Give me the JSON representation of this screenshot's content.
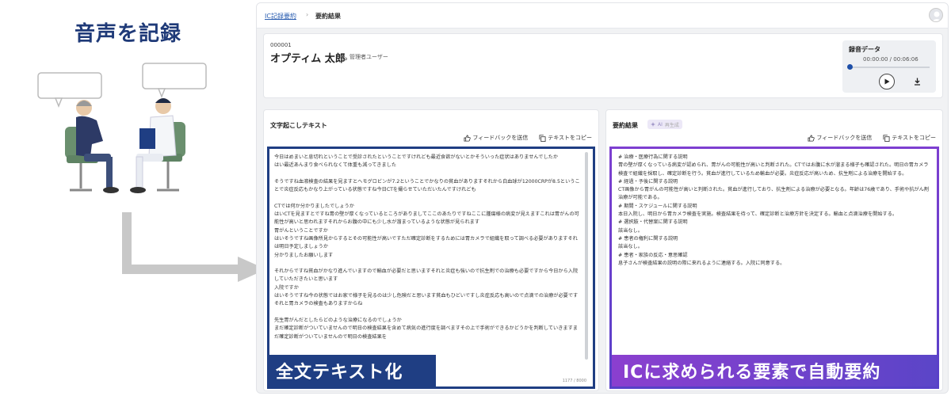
{
  "promo": {
    "left_title": "音声を記録",
    "left_banner": "全文テキスト化",
    "right_banner": "ICに求められる要素で自動要約"
  },
  "breadcrumb": {
    "parent": "IC記録要約",
    "separator": "›",
    "current": "要約結果"
  },
  "patient": {
    "id": "000001",
    "name": "オプティム 太郎",
    "role": "管理者ユーザー"
  },
  "recording": {
    "title": "録音データ",
    "time": "00:00:00 / 00:06:06",
    "progress": 0
  },
  "transcript": {
    "title": "文字起こしテキスト",
    "feedback_label": "フィードバックを送信",
    "copy_label": "テキストをコピー",
    "count": "1177 / 8000",
    "text": "今日はめまいと息切れということで受診されたということですけれども最近食欲がないとかそういった症状はありませんでしたか\nはい最近あんまり食べられなくて体重も減ってきました\n\nそうですね血液検査の結果を見ますとヘモグロビンが7.2ということでかなりの貧血がありますそれから白血球が12000CRPが8.5ということで炎症反応もかなり上がっている状態ですね今日CTを撮らせていただいたんですけれども\n\nCTでは何か分かりましたでしょうか\nはいCTを見ますとですね胃の壁が厚くなっているところがありましてここのあたりですねここに腫瘍様の病変が見えますこれは胃がんの可能性が高いと思われますそれからお腹の中にも少し水が溜まっているような状態が見られます\n胃がんということですか\nはいそうですね画像所見からするとその可能性が高いですただ確定診断をするためには胃カメラで組織を取って調べる必要がありますそれは明日予定しましょうか\n分かりましたお願いします\n\nそれからですね貧血がかなり進んでいますので輸血が必要だと思いますそれと炎症も強いので抗生剤での治療も必要ですから今日から入院していただきたいと思います\n入院ですか\nはいそうですね今の状態ではお家で様子を見るのは少し危険だと思います貧血もひどいですし炎症反応も高いので点滴での治療が必要ですそれと胃カメラの検査もありますからね\n\n先生胃がんだとしたらどのような治療になるのでしょうか\nまだ確定診断がついていませんので明日の検査結果を含めて病気の進行度を調べますその上で手術ができるかどうかを判断していきますまだ確定診断がついていませんので明日の検査結果を"
  },
  "summary": {
    "title": "要約結果",
    "ai_badge": "AI",
    "regen_label": "再生成",
    "feedback_label": "フィードバックを送信",
    "copy_label": "テキストをコピー",
    "text": "# 治療・医療行為に関する説明\n胃の壁が厚くなっている病変が認められ、胃がんの可能性が高いと判断された。CTではお腹に水が溜まる様子も確認された。明日の胃カメラ検査で組織を採取し、確定診断を行う。貧血が進行しているため輸血が必要。炎症反応が高いため、抗生剤による治療を開始する。\n# 経過・予後に関する説明\nCT画像から胃がんの可能性が高いと判断された。貧血が進行しており、抗生剤による治療が必要となる。年齢は76歳であり、手術や抗がん剤治療が可能である。\n# 期間・スケジュールに関する説明\n本日入院し、明日から胃カメラ検査を実施。検査結果を待って、確定診断と治療方針を決定する。輸血と点滴治療を開始する。\n# 選択肢・代替案に関する説明\n該当なし。\n# 患者の権利に関する説明\n該当なし。\n# 患者・家族の反応・意思確認\n息子さんが検査結果の説明の際に来れるように連絡する。入院に同意する。"
  }
}
